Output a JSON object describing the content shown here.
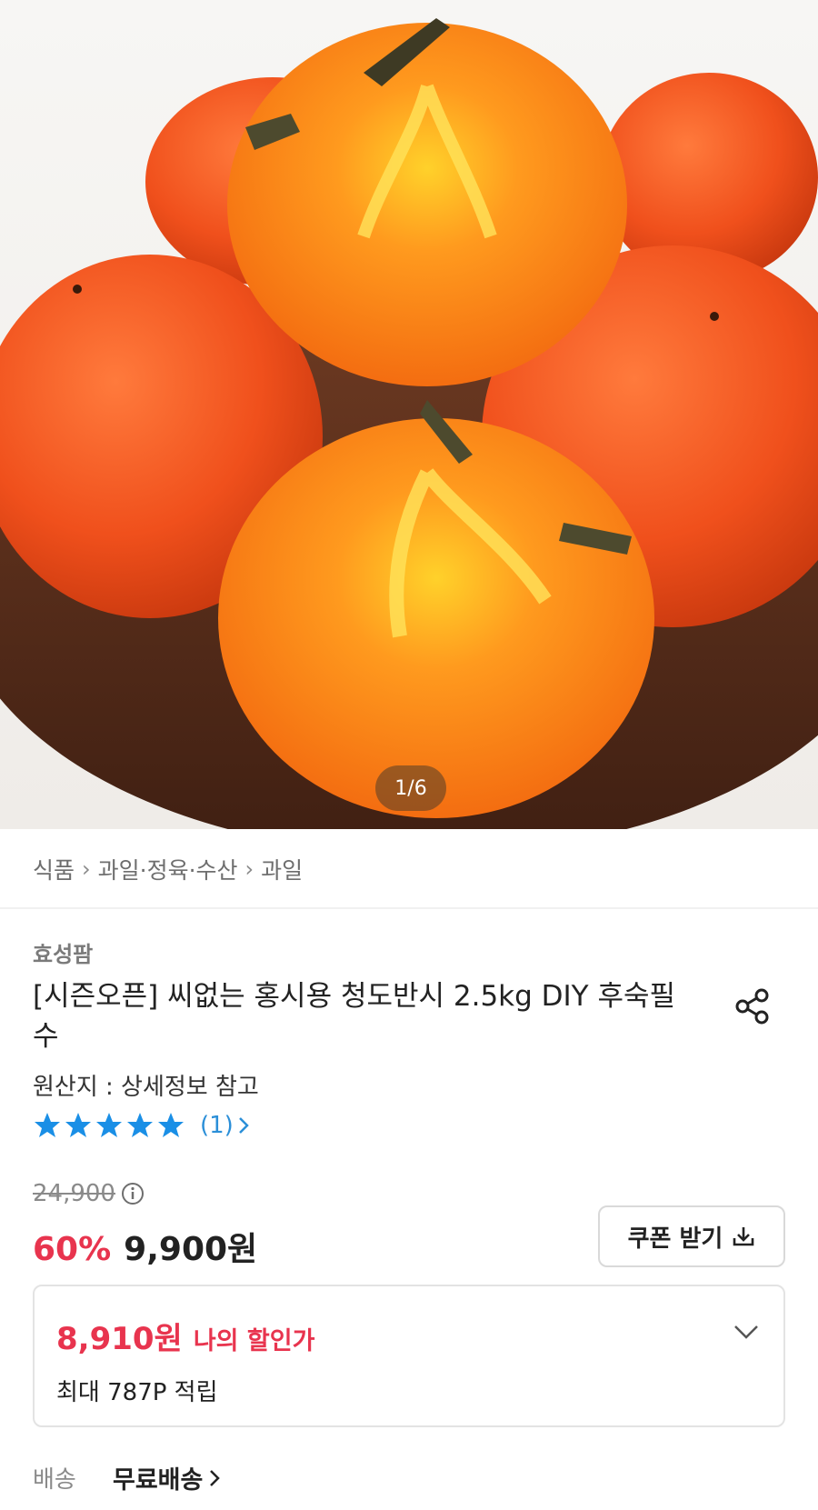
{
  "hero": {
    "image_subject": "persimmons",
    "page_indicator": "1/6"
  },
  "breadcrumb": {
    "items": [
      "식품",
      "과일·정육·수산",
      "과일"
    ]
  },
  "product": {
    "seller": "효성팜",
    "title": "[시즌오픈] 씨없는 홍시용 청도반시 2.5kg DIY 후숙필수",
    "origin": "원산지 : 상세정보 참고",
    "rating": {
      "stars": 5,
      "count_text": "(1)"
    },
    "original_price": "24,900",
    "discount": "60%",
    "price": "9,900원",
    "coupon_label": "쿠폰 받기"
  },
  "my_price": {
    "amount": "8,910원",
    "label": "나의 할인가",
    "points": "최대 787P 적립"
  },
  "shipping": {
    "label": "배송",
    "value": "무료배송"
  },
  "colors": {
    "accent_red": "#e8344e",
    "star_blue": "#1a8fe6",
    "link_blue": "#2b8fd8"
  }
}
